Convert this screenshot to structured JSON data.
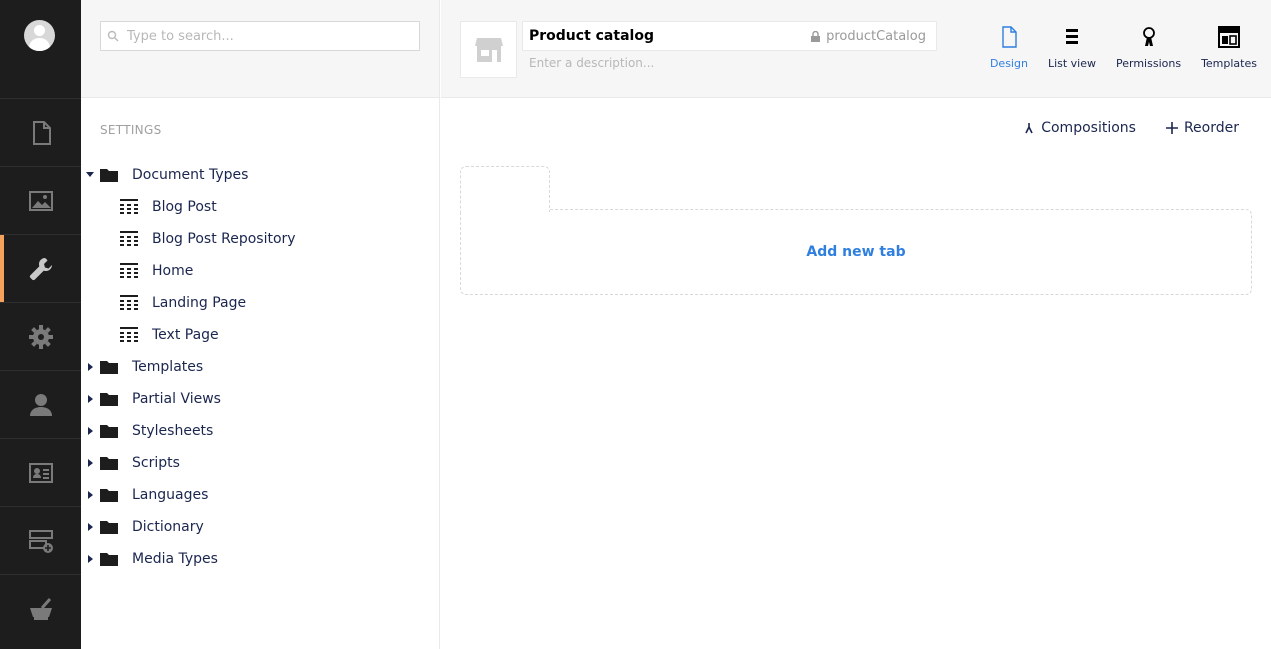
{
  "appbar": {
    "sections": [
      {
        "icon": "document-icon",
        "active": false
      },
      {
        "icon": "image-icon",
        "active": false
      },
      {
        "icon": "wrench-icon",
        "active": true
      },
      {
        "icon": "gear-icon",
        "active": false
      },
      {
        "icon": "user-icon",
        "active": false
      },
      {
        "icon": "member-card-icon",
        "active": false
      },
      {
        "icon": "forms-icon",
        "active": false
      },
      {
        "icon": "mortar-icon",
        "active": false
      }
    ],
    "accent": "#f5a25c"
  },
  "tree": {
    "search_placeholder": "Type to search...",
    "section_title": "SETTINGS",
    "document_types": {
      "label": "Document Types",
      "children": [
        "Blog Post",
        "Blog Post Repository",
        "Home",
        "Landing Page",
        "Text Page"
      ]
    },
    "folders": [
      "Templates",
      "Partial Views",
      "Stylesheets",
      "Scripts",
      "Languages",
      "Dictionary",
      "Media Types"
    ]
  },
  "editor": {
    "name": "Product catalog",
    "alias": "productCatalog",
    "description_placeholder": "Enter a description...",
    "views": [
      {
        "label": "Design",
        "active": true
      },
      {
        "label": "List view",
        "active": false
      },
      {
        "label": "Permissions",
        "active": false
      },
      {
        "label": "Templates",
        "active": false
      }
    ],
    "actions": {
      "compositions": "Compositions",
      "reorder": "Reorder"
    },
    "add_tab": "Add new tab"
  },
  "colors": {
    "link_blue": "#2f7fdf",
    "text": "#1b264f"
  }
}
